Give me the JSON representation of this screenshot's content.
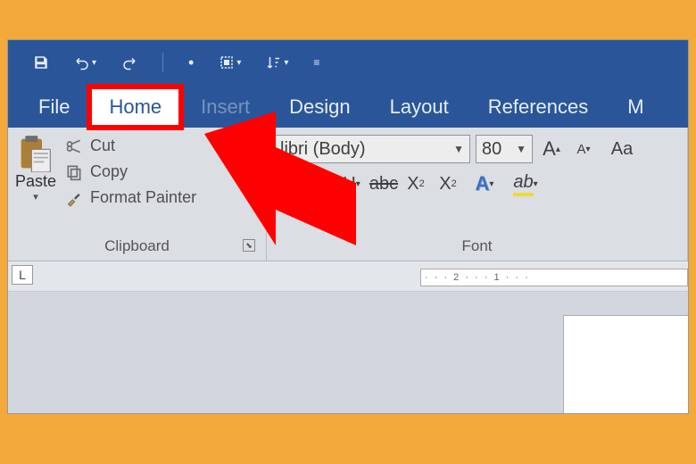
{
  "tabs": {
    "file": "File",
    "home": "Home",
    "insert": "Insert",
    "design": "Design",
    "layout": "Layout",
    "references": "References",
    "mailings": "M"
  },
  "clipboard": {
    "paste": "Paste",
    "cut": "Cut",
    "copy": "Copy",
    "format_painter": "Format Painter",
    "group_label": "Clipboard"
  },
  "font": {
    "name": "libri (Body)",
    "size": "80",
    "group_label": "Font",
    "aa": "Aa"
  },
  "ruler": {
    "tabstop": "L",
    "marks": "· · · 2 · · · 1 · · ·"
  }
}
